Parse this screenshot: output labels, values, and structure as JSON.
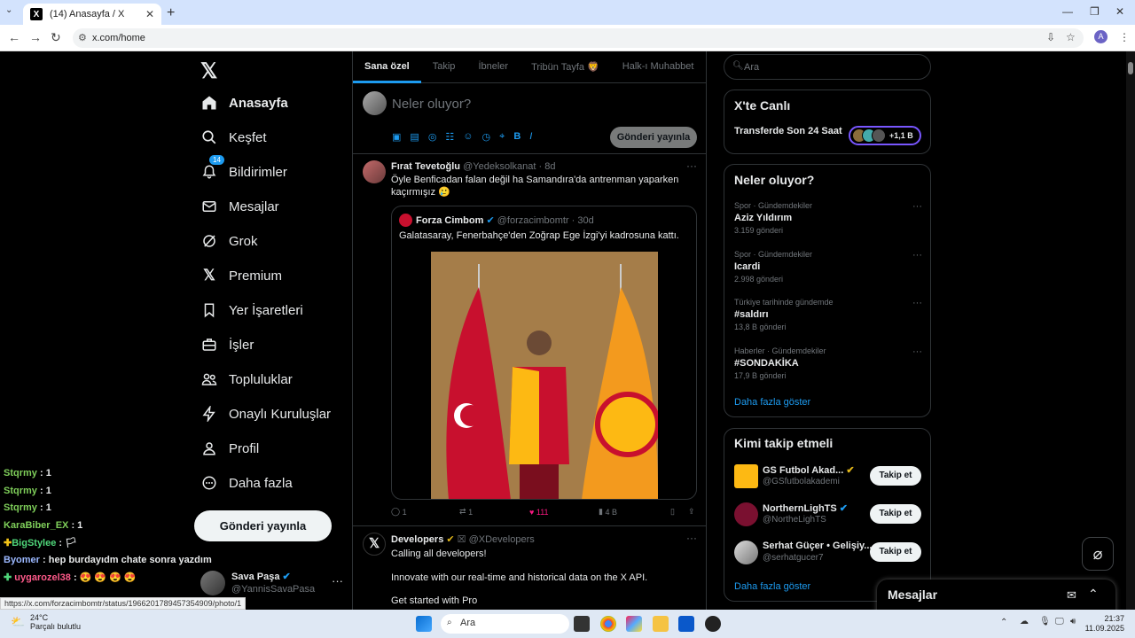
{
  "browser": {
    "tab_title": "(14) Anasayfa / X",
    "url": "x.com/home",
    "avatar_letter": "A",
    "status_url": "https://x.com/forzacimbomtr/status/1966201789457354909/photo/1"
  },
  "nav": {
    "items": [
      {
        "label": "Anasayfa",
        "icon": "home-icon"
      },
      {
        "label": "Keşfet",
        "icon": "search-icon"
      },
      {
        "label": "Bildirimler",
        "icon": "bell-icon",
        "badge": "14"
      },
      {
        "label": "Mesajlar",
        "icon": "mail-icon"
      },
      {
        "label": "Grok",
        "icon": "grok-icon"
      },
      {
        "label": "Premium",
        "icon": "x-icon"
      },
      {
        "label": "Yer İşaretleri",
        "icon": "bookmark-icon"
      },
      {
        "label": "İşler",
        "icon": "briefcase-icon"
      },
      {
        "label": "Topluluklar",
        "icon": "people-icon"
      },
      {
        "label": "Onaylı Kuruluşlar",
        "icon": "lightning-icon"
      },
      {
        "label": "Profil",
        "icon": "person-icon"
      },
      {
        "label": "Daha fazla",
        "icon": "more-circle-icon"
      }
    ],
    "post_button": "Gönderi yayınla",
    "me": {
      "name": "Sava Paşa",
      "handle": "@YannisSavaPasa"
    }
  },
  "chat": [
    {
      "user": "Stqrmy",
      "msg": ": 1",
      "color": "#7fcf5a"
    },
    {
      "user": "Stqrmy",
      "msg": ": 1",
      "color": "#7fcf5a"
    },
    {
      "user": "Stqrmy",
      "msg": ": 1",
      "color": "#7fcf5a"
    },
    {
      "user": "KaraBiber_EX",
      "msg": ": 1",
      "color": "#7fcf5a"
    },
    {
      "user": "BigStylee",
      "msg": ":",
      "color": "#4fd67a"
    },
    {
      "user": "Byomer",
      "msg": ": hep burdayıdm chate sonra yazdım",
      "color": "#9bb8ff"
    },
    {
      "user": "uygarozel38",
      "msg": ":",
      "color": "#ff5a8a"
    }
  ],
  "feed": {
    "tabs": [
      "Sana özel",
      "Takip",
      "İbneler",
      "Tribün Tayfa 🦁",
      "Halk-ı Muhabbet"
    ],
    "composer_placeholder": "Neler oluyor?",
    "composer_button": "Gönderi yayınla",
    "tweet1": {
      "name": "Fırat Tevetoğlu",
      "handle": "@Yedeksolkanat",
      "time": "· 8d",
      "text": "Öyle Benficadan falan değil ha Samandıra'da antrenman yaparken kaçırmışız 🥲",
      "quote": {
        "name": "Forza Cimbom",
        "handle": "@forzacimbomtr",
        "time": "· 30d",
        "text": "Galatasaray, Fenerbahçe'den Zoğrap Ege İzgi'yi kadrosuna kattı."
      },
      "replies": "1",
      "reposts": "1",
      "likes": "111",
      "views": "4 B"
    },
    "tweet2": {
      "name": "Developers",
      "handle": "@XDevelopers",
      "line1": "Calling all developers!",
      "line2": "Innovate with our real-time and historical data on the X API.",
      "line3": "Get started with Pro"
    }
  },
  "sidebar": {
    "search_placeholder": "Ara",
    "live": {
      "title": "X'te Canlı",
      "item": "Transferde Son 24 Saat",
      "count": "+1,1 B"
    },
    "trends_title": "Neler oluyor?",
    "trends": [
      {
        "context": "Spor · Gündemdekiler",
        "topic": "Aziz Yıldırım",
        "count": "3.159 gönderi"
      },
      {
        "context": "Spor · Gündemdekiler",
        "topic": "Icardi",
        "count": "2.998 gönderi"
      },
      {
        "context": "Türkiye tarihinde gündemde",
        "topic": "#saldırı",
        "count": "13,8 B gönderi"
      },
      {
        "context": "Haberler · Gündemdekiler",
        "topic": "#SONDAKİKA",
        "count": "17,9 B gönderi"
      }
    ],
    "show_more": "Daha fazla göster",
    "who_title": "Kimi takip etmeli",
    "who": [
      {
        "name": "GS Futbol Akad...",
        "handle": "@GSfutbolakademi",
        "button": "Takip et"
      },
      {
        "name": "NorthernLighTS",
        "handle": "@NortheLighTS",
        "button": "Takip et"
      },
      {
        "name": "Serhat Güçer • Gelişiy...",
        "handle": "@serhatgucer7",
        "button": "Takip et"
      }
    ],
    "who_more": "Daha fazla göster",
    "messages_dock": "Mesajlar"
  },
  "taskbar": {
    "temp": "24°C",
    "weather": "Parçalı bulutlu",
    "search": "Ara",
    "time": "21:37",
    "date": "11.09.2025"
  }
}
